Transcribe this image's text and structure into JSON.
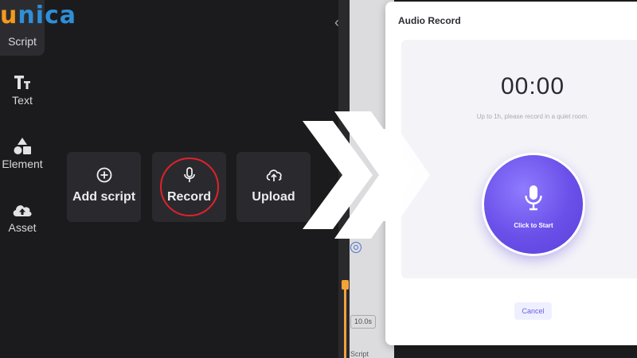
{
  "brand": {
    "logo_u": "u",
    "logo_rest": "nica"
  },
  "sidebar": {
    "items": [
      {
        "label": "Script",
        "icon": "script-icon",
        "active": true
      },
      {
        "label": "Text",
        "icon": "text-icon",
        "active": false
      },
      {
        "label": "Element",
        "icon": "element-icon",
        "active": false
      },
      {
        "label": "Asset",
        "icon": "asset-icon",
        "active": false
      }
    ]
  },
  "tools": {
    "add_script": {
      "label": "Add script",
      "icon": "plus-circle-icon"
    },
    "record": {
      "label": "Record",
      "icon": "microphone-icon"
    },
    "upload": {
      "label": "Upload",
      "icon": "upload-cloud-icon"
    }
  },
  "timeline": {
    "time_chip": "10.0s",
    "clip_label": "Script"
  },
  "dialog": {
    "title": "Audio Record",
    "timer": "00:00",
    "hint": "Up to 1h, please record in a quiet room.",
    "start_label": "Click to Start",
    "cancel_label": "Cancel"
  },
  "colors": {
    "accent": "#6c5ce7",
    "highlight_ring": "#e0222a",
    "logo_blue": "#2e8fd8",
    "logo_orange": "#f39a1b",
    "timeline_marker": "#f2a33a"
  }
}
